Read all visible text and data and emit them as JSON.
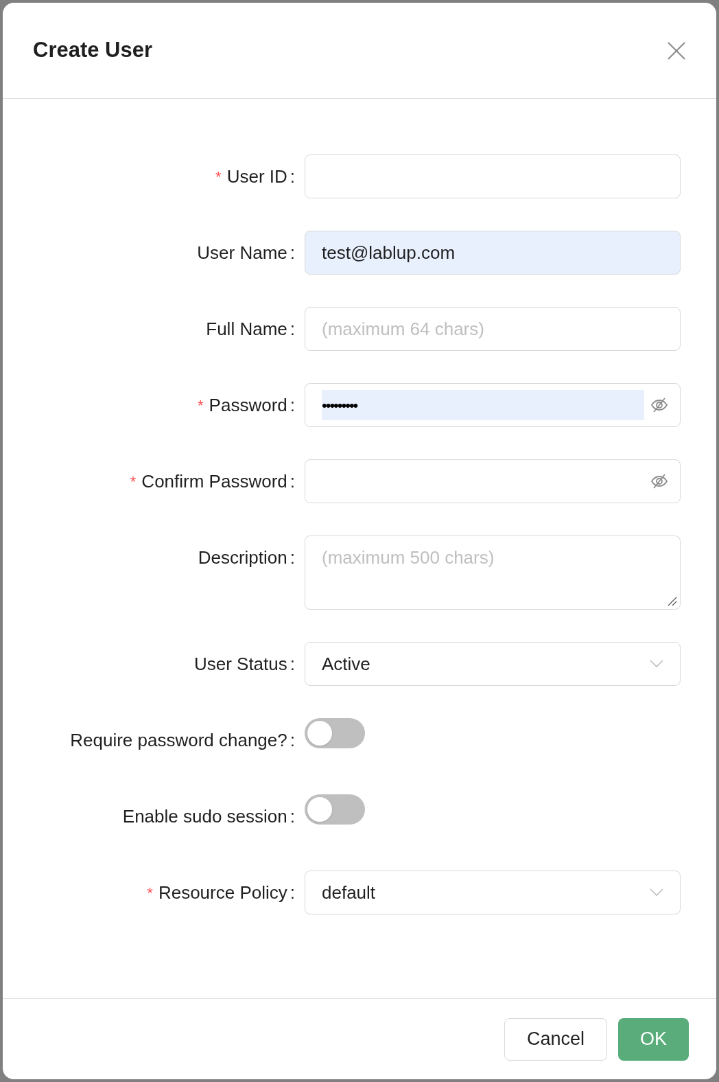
{
  "dialog": {
    "title": "Create User"
  },
  "marks": {
    "required": "*",
    "colon": ":"
  },
  "fields": [
    {
      "kind": "text",
      "label": "User ID",
      "required": true,
      "highlighted": false
    },
    {
      "kind": "text",
      "label": "User Name",
      "required": false,
      "value": "test@lablup.com",
      "highlighted": true
    },
    {
      "kind": "text",
      "label": "Full Name",
      "required": false,
      "placeholder": "(maximum 64 chars)",
      "highlighted": false
    },
    {
      "kind": "password",
      "label": "Password",
      "required": true,
      "value": "•••••••••",
      "highlighted": true
    },
    {
      "kind": "password",
      "label": "Confirm Password",
      "required": true,
      "highlighted": false
    },
    {
      "kind": "textarea",
      "label": "Description",
      "required": false,
      "placeholder": "(maximum 500 chars)"
    },
    {
      "kind": "select",
      "label": "User Status",
      "required": false,
      "value": "Active"
    },
    {
      "kind": "switch",
      "label": "Require password change?",
      "required": false,
      "on": false
    },
    {
      "kind": "switch",
      "label": "Enable sudo session",
      "required": false,
      "on": false
    },
    {
      "kind": "select",
      "label": "Resource Policy",
      "required": true,
      "value": "default"
    }
  ],
  "buttons": [
    {
      "kind": "secondary",
      "label": "Cancel"
    },
    {
      "kind": "primary",
      "label": "OK"
    }
  ]
}
